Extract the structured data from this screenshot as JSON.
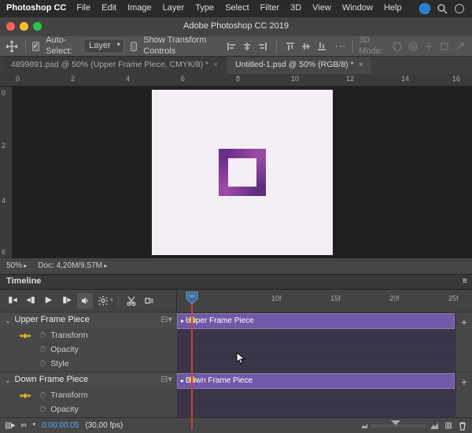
{
  "menubar": {
    "app": "Photoshop CC",
    "items": [
      "File",
      "Edit",
      "Image",
      "Layer",
      "Type",
      "Select",
      "Filter",
      "3D",
      "View",
      "Window",
      "Help"
    ]
  },
  "window_title": "Adobe Photoshop CC 2019",
  "options_bar": {
    "auto_select_label": "Auto-Select:",
    "auto_select_value": "Layer",
    "show_transform_label": "Show Transform Controls",
    "mode_label": "3D Mode:"
  },
  "doc_tabs": [
    {
      "label": "4899891.psd @ 50% (Upper Frame Piece, CMYK/8) *"
    },
    {
      "label": "Untitled-1.psd @ 50% (RGB/8) *"
    }
  ],
  "ruler_h": [
    "0",
    "2",
    "4",
    "6",
    "8",
    "10",
    "12",
    "14",
    "16"
  ],
  "ruler_v": [
    "0",
    "2",
    "4",
    "6"
  ],
  "status": {
    "zoom": "50%",
    "doc": "Doc: 4,20M/9,57M"
  },
  "timeline": {
    "title": "Timeline",
    "ticks": [
      "10f",
      "15f",
      "20f",
      "25f"
    ],
    "layers": [
      {
        "name": "Upper Frame Piece",
        "clip": "Upper Frame Piece",
        "props": [
          "Transform",
          "Opacity",
          "Style"
        ]
      },
      {
        "name": "Down Frame Piece",
        "clip": "Down Frame Piece",
        "props": [
          "Transform",
          "Opacity"
        ]
      }
    ],
    "footer": {
      "loop": "∞",
      "time": "0:00:00:05",
      "fps": "(30,00 fps)"
    }
  }
}
